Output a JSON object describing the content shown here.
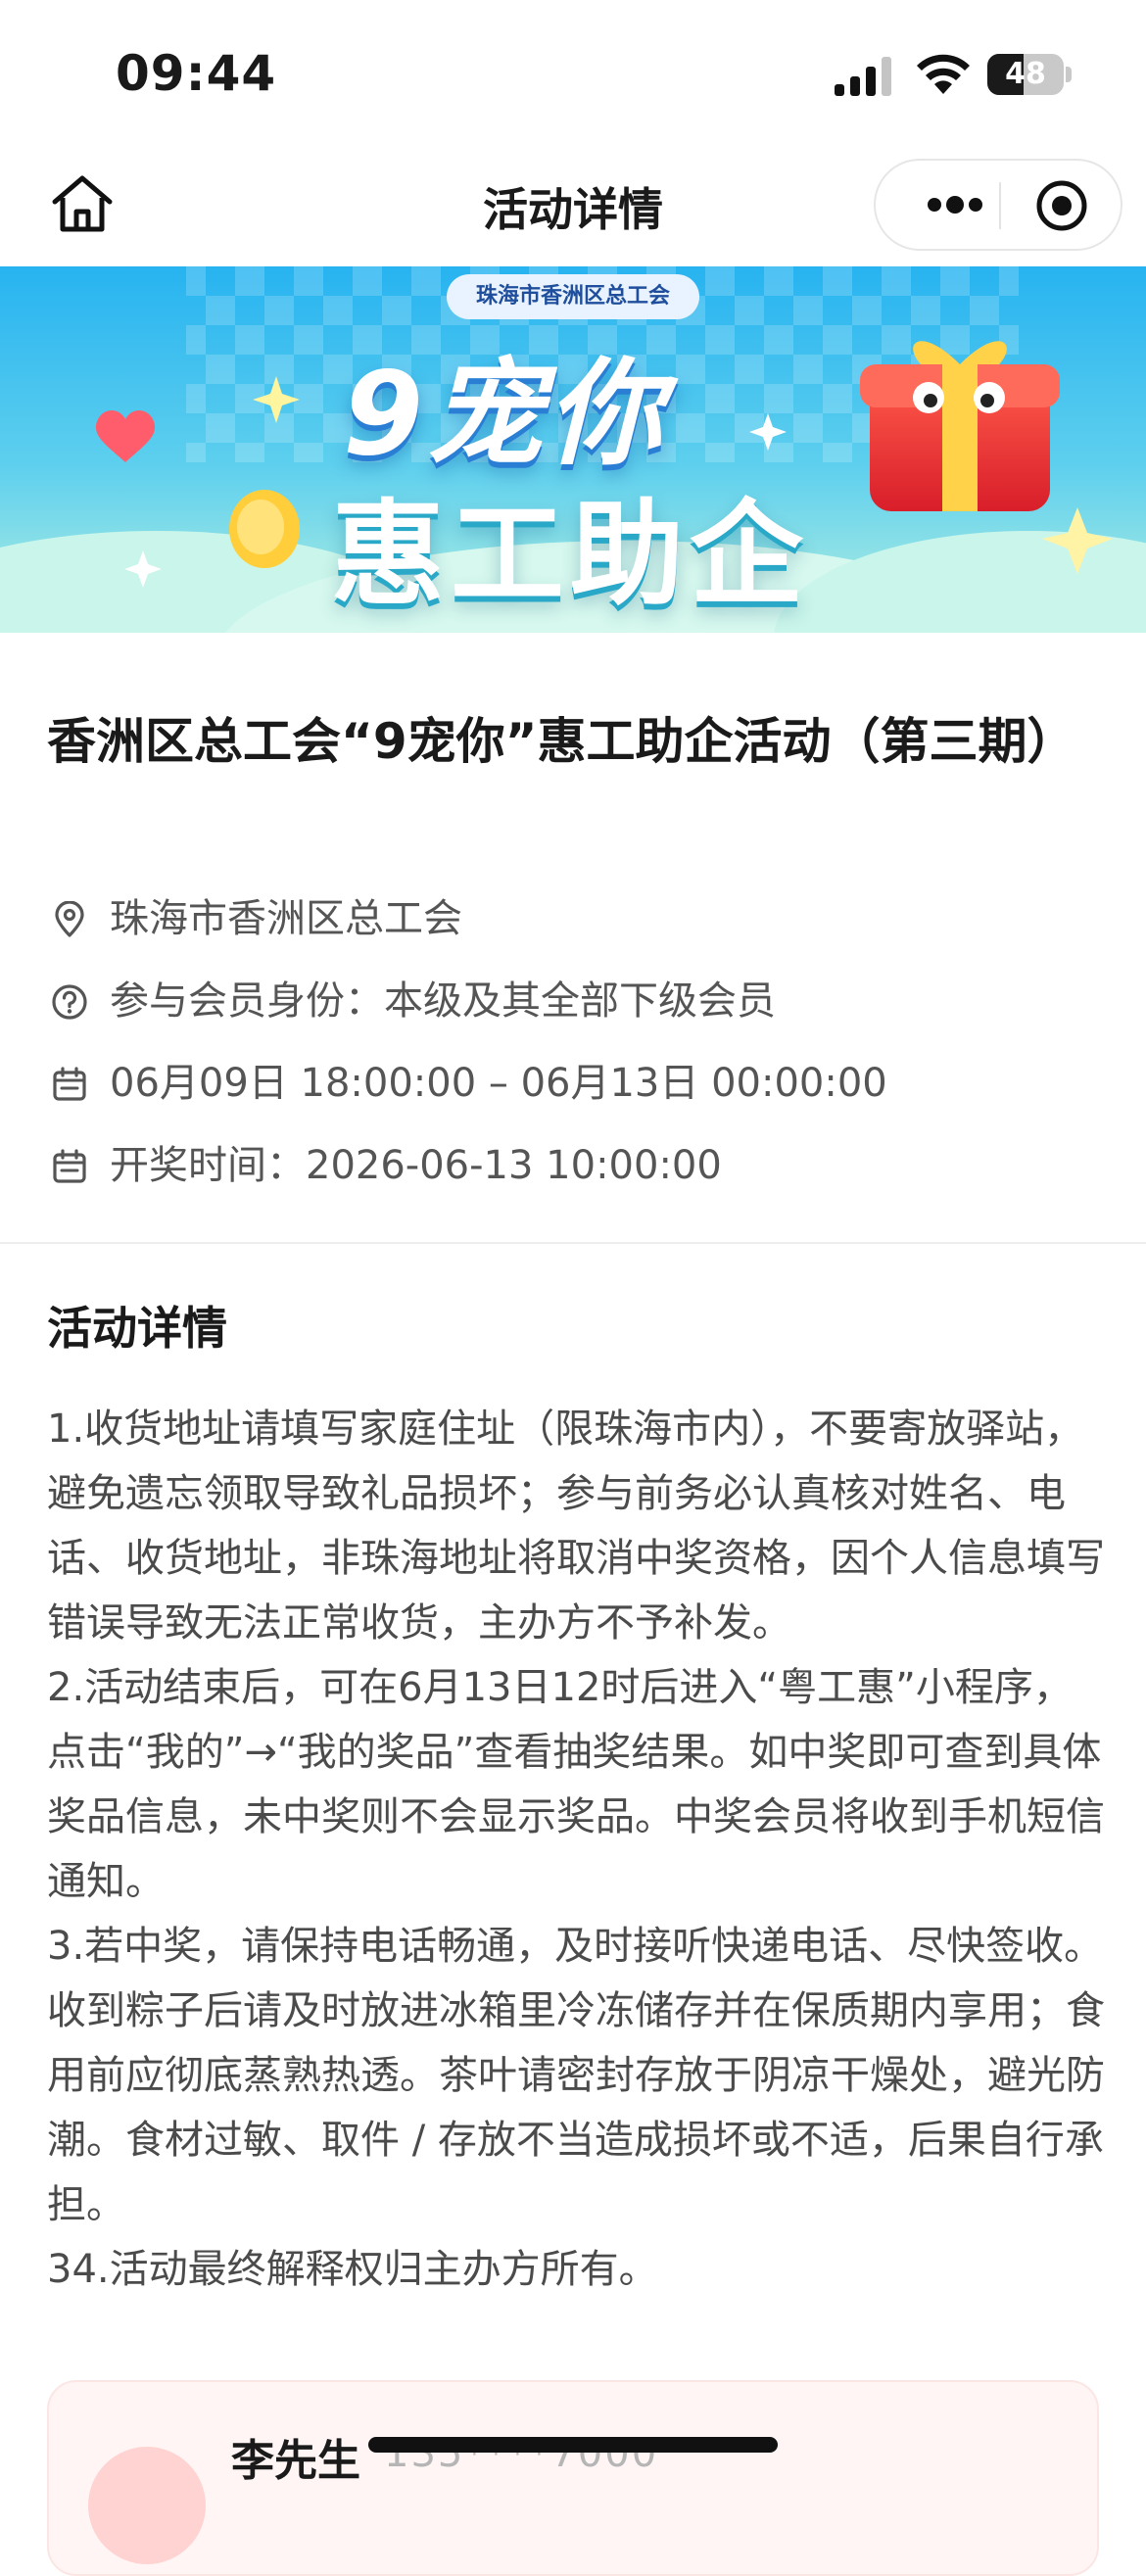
{
  "status_bar": {
    "time": "09:44",
    "battery": "48",
    "battery_level": 0.48
  },
  "nav": {
    "title": "活动详情"
  },
  "banner": {
    "org": "珠海市香洲区总工会",
    "line1": "9宠你",
    "line2": "惠工助企"
  },
  "event": {
    "title": "香洲区总工会“9宠你”惠工助企活动（第三期）",
    "organizer": "珠海市香洲区总工会",
    "member_identity": "参与会员身份：本级及其全部下级会员",
    "time_range": "06月09日 18:00:00 – 06月13日 00:00:00",
    "draw_time": "开奖时间：2026-06-13 10:00:00"
  },
  "details": {
    "heading": "活动详情",
    "items": [
      "1.收货地址请填写家庭住址（限珠海市内），不要寄放驿站，避免遗忘领取导致礼品损坏；参与前务必认真核对姓名、电话、收货地址，非珠海地址将取消中奖资格，因个人信息填写错误导致无法正常收货，主办方不予补发。",
      "2.活动结束后，可在6月13日12时后进入“粤工惠”小程序，点击“我的”→“我的奖品”查看抽奖结果。如中奖即可查到具体奖品信息，未中奖则不会显示奖品。中奖会员将收到手机短信通知。",
      "3.若中奖，请保持电话畅通，及时接听快递电话、尽快签收。收到粽子后请及时放进冰箱里冷冻储存并在保质期内享用；食用前应彻底蒸熟热透。茶叶请密封存放于阴凉干燥处，避光防潮。食材过敏、取件 / 存放不当造成损坏或不适，后果自行承担。",
      "34.活动最终解释权归主办方所有。"
    ]
  },
  "contact": {
    "name": "李先生",
    "phone": "135****7000"
  },
  "colors": {
    "banner_top": "#28b8f2",
    "banner_bottom": "#9be8e0",
    "text_secondary": "#555555"
  }
}
